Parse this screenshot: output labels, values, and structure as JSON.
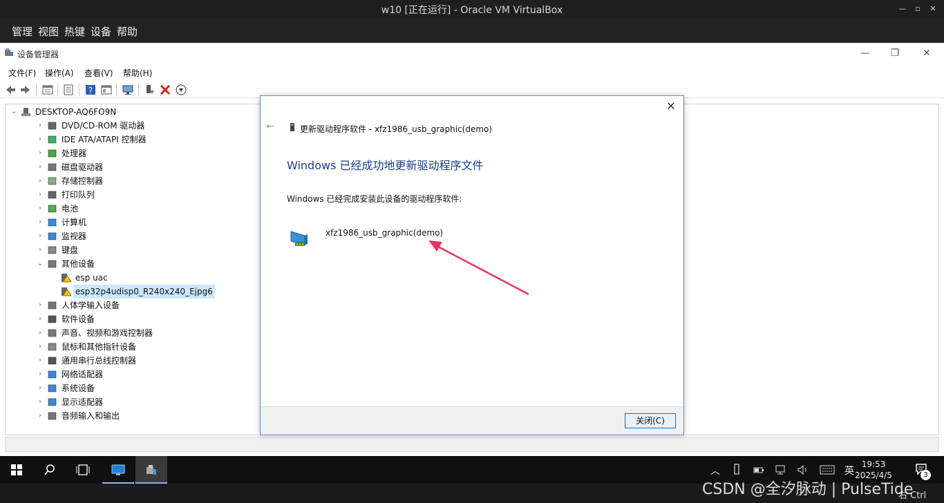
{
  "vbox": {
    "title": "w10 [正在运行] - Oracle VM VirtualBox",
    "menu": [
      "管理",
      "视图",
      "热键",
      "设备",
      "帮助"
    ]
  },
  "devmgr": {
    "title": "设备管理器",
    "menu": [
      "文件(F)",
      "操作(A)",
      "查看(V)",
      "帮助(H)"
    ],
    "root": "DESKTOP-AQ6FO9N",
    "categories": [
      {
        "label": "DVD/CD-ROM 驱动器",
        "icon": "dvd-drive-icon"
      },
      {
        "label": "IDE ATA/ATAPI 控制器",
        "icon": "ide-controller-icon"
      },
      {
        "label": "处理器",
        "icon": "processor-icon"
      },
      {
        "label": "磁盘驱动器",
        "icon": "disk-drive-icon"
      },
      {
        "label": "存储控制器",
        "icon": "storage-controller-icon"
      },
      {
        "label": "打印队列",
        "icon": "printer-icon"
      },
      {
        "label": "电池",
        "icon": "battery-icon"
      },
      {
        "label": "计算机",
        "icon": "computer-icon"
      },
      {
        "label": "监视器",
        "icon": "monitor-icon"
      },
      {
        "label": "键盘",
        "icon": "keyboard-icon"
      },
      {
        "label": "其他设备",
        "icon": "unknown-device-icon",
        "expanded": true,
        "children": [
          {
            "label": "esp uac",
            "icon": "warning-device-icon"
          },
          {
            "label": "esp32p4udisp0_R240x240_Ejpg6",
            "icon": "warning-device-icon",
            "selected": true
          }
        ]
      },
      {
        "label": "人体学输入设备",
        "icon": "hid-icon"
      },
      {
        "label": "软件设备",
        "icon": "software-device-icon"
      },
      {
        "label": "声音、视频和游戏控制器",
        "icon": "sound-icon"
      },
      {
        "label": "鼠标和其他指针设备",
        "icon": "mouse-icon"
      },
      {
        "label": "通用串行总线控制器",
        "icon": "usb-icon"
      },
      {
        "label": "网络适配器",
        "icon": "network-adapter-icon"
      },
      {
        "label": "系统设备",
        "icon": "system-device-icon"
      },
      {
        "label": "显示适配器",
        "icon": "display-adapter-icon"
      },
      {
        "label": "音频输入和输出",
        "icon": "audio-io-icon"
      }
    ]
  },
  "dialog": {
    "header": "更新驱动程序软件 - xfz1986_usb_graphic(demo)",
    "heading": "Windows 已经成功地更新驱动程序文件",
    "description": "Windows 已经完成安装此设备的驱动程序软件:",
    "device_name": "xfz1986_usb_graphic(demo)",
    "close_label": "关闭(C)",
    "close_x": "✕"
  },
  "taskbar": {
    "ime": "英",
    "time": "19:53",
    "date": "2025/4/5",
    "notifications": "3"
  },
  "watermark": "CSDN @全汐脉动 | PulseTide",
  "vbox_status": "右 Ctrl"
}
